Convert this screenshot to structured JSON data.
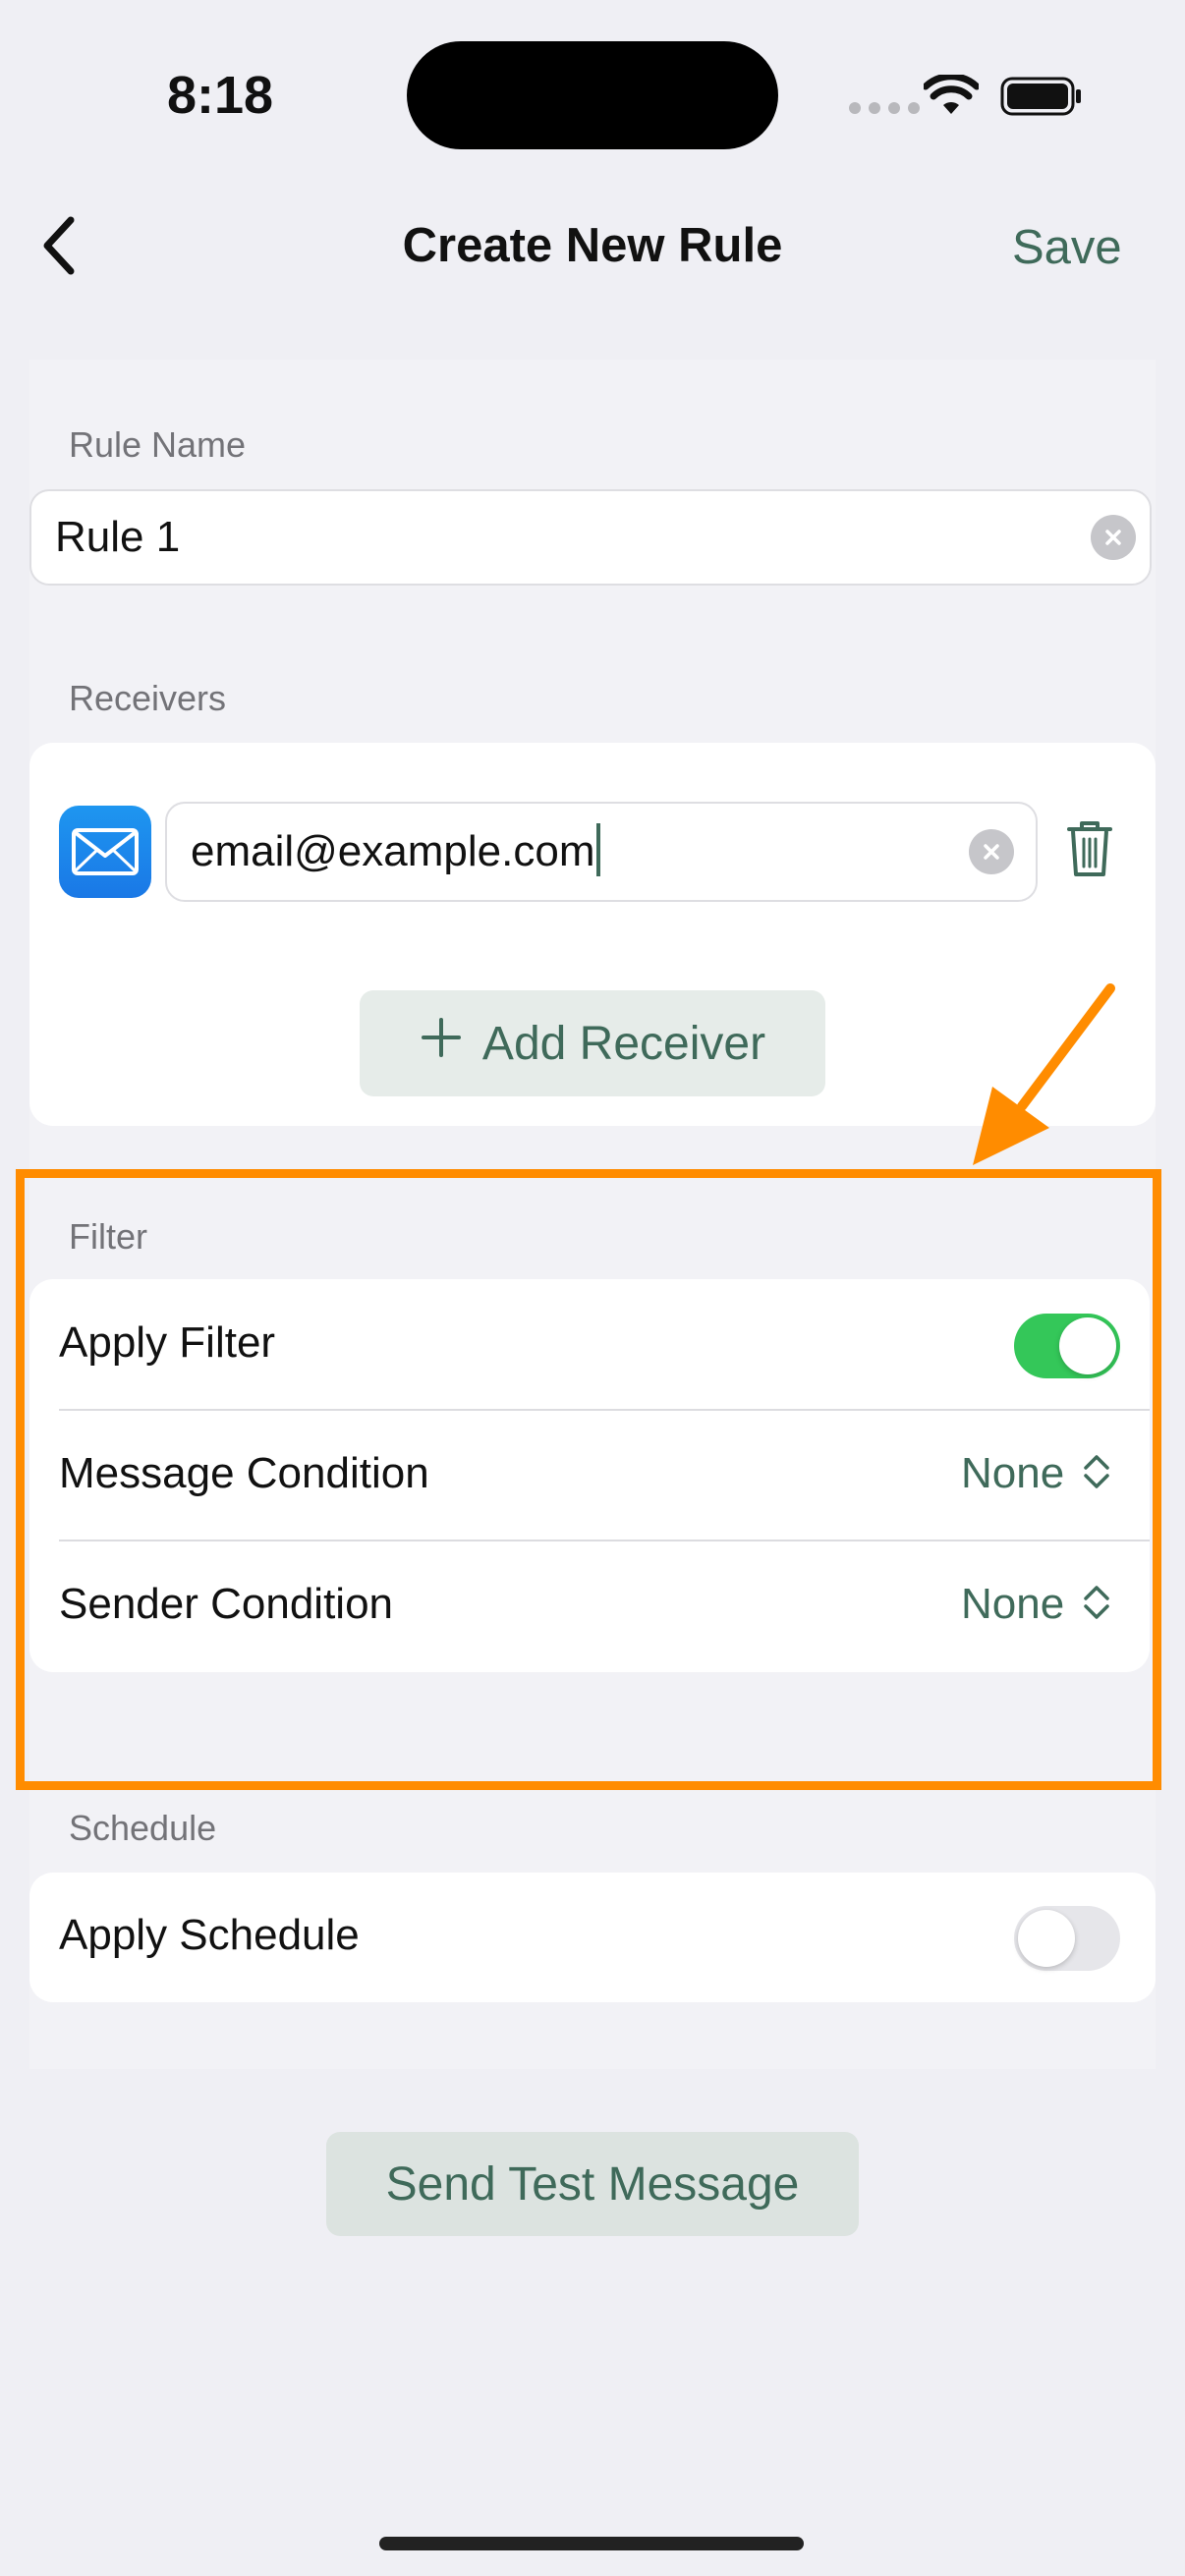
{
  "status_bar": {
    "time": "8:18"
  },
  "nav": {
    "title": "Create New Rule",
    "save_label": "Save"
  },
  "rule_name": {
    "section_label": "Rule Name",
    "value": "Rule 1"
  },
  "receivers": {
    "section_label": "Receivers",
    "items": [
      {
        "type_icon": "mail-icon",
        "value": "email@example.com"
      }
    ],
    "add_label": "Add Receiver"
  },
  "filter": {
    "section_label": "Filter",
    "apply_label": "Apply Filter",
    "apply_on": true,
    "message_condition_label": "Message Condition",
    "message_condition_value": "None",
    "sender_condition_label": "Sender Condition",
    "sender_condition_value": "None"
  },
  "schedule": {
    "section_label": "Schedule",
    "apply_label": "Apply Schedule",
    "apply_on": false
  },
  "send_test_label": "Send Test Message",
  "colors": {
    "accent": "#3f6a5a",
    "toggle_on": "#34c759",
    "highlight": "#ff8c00",
    "background": "#efeff4"
  }
}
